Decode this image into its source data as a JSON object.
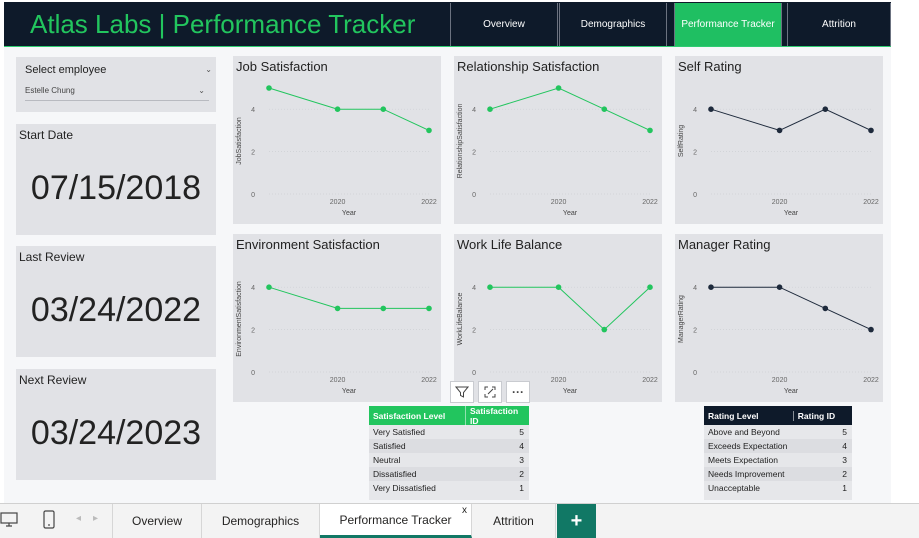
{
  "header": {
    "title": "Atlas Labs | Performance Tracker",
    "nav": [
      {
        "label": "Overview",
        "active": false
      },
      {
        "label": "Demographics",
        "active": false
      },
      {
        "label": "Performance Tracker",
        "active": true
      },
      {
        "label": "Attrition",
        "active": false
      }
    ]
  },
  "slicer": {
    "label": "Select employee",
    "value": "Estelle Chung"
  },
  "cards": {
    "start": {
      "label": "Start Date",
      "value": "07/15/2018"
    },
    "last": {
      "label": "Last Review",
      "value": "03/24/2022"
    },
    "next": {
      "label": "Next Review",
      "value": "03/24/2023"
    }
  },
  "chart_data": [
    {
      "type": "line",
      "title": "Job Satisfaction",
      "xlabel": "Year",
      "ylabel": "JobSatisfaction",
      "x": [
        2018.5,
        2020,
        2021,
        2022
      ],
      "values": [
        5,
        4,
        4,
        3
      ],
      "xticks": [
        "2020",
        "2022"
      ],
      "yticks": [
        "0",
        "2",
        "4"
      ],
      "ylim": [
        0,
        5
      ],
      "color": "#22c55e"
    },
    {
      "type": "line",
      "title": "Relationship Satisfaction",
      "xlabel": "Year",
      "ylabel": "RelationshipSatisfaction",
      "x": [
        2018.5,
        2020,
        2021,
        2022
      ],
      "values": [
        4,
        5,
        4,
        3
      ],
      "xticks": [
        "2020",
        "2022"
      ],
      "yticks": [
        "0",
        "2",
        "4"
      ],
      "ylim": [
        0,
        5
      ],
      "color": "#22c55e"
    },
    {
      "type": "line",
      "title": "Self Rating",
      "xlabel": "Year",
      "ylabel": "SelfRating",
      "x": [
        2018.5,
        2020,
        2021,
        2022
      ],
      "values": [
        4,
        3,
        4,
        3
      ],
      "xticks": [
        "2020",
        "2022"
      ],
      "yticks": [
        "0",
        "2",
        "4"
      ],
      "ylim": [
        0,
        5
      ],
      "color": "#1e2a3c"
    },
    {
      "type": "line",
      "title": "Environment Satisfaction",
      "xlabel": "Year",
      "ylabel": "EnvironmentSatisfaction",
      "x": [
        2018.5,
        2020,
        2021,
        2022
      ],
      "values": [
        4,
        3,
        3,
        3
      ],
      "xticks": [
        "2020",
        "2022"
      ],
      "yticks": [
        "0",
        "2",
        "4"
      ],
      "ylim": [
        0,
        5
      ],
      "color": "#22c55e"
    },
    {
      "type": "line",
      "title": "Work Life Balance",
      "xlabel": "Year",
      "ylabel": "WorkLifeBalance",
      "x": [
        2018.5,
        2020,
        2021,
        2022
      ],
      "values": [
        4,
        4,
        2,
        4
      ],
      "xticks": [
        "2020",
        "2022"
      ],
      "yticks": [
        "0",
        "2",
        "4"
      ],
      "ylim": [
        0,
        5
      ],
      "color": "#22c55e"
    },
    {
      "type": "line",
      "title": "Manager Rating",
      "xlabel": "Year",
      "ylabel": "ManagerRating",
      "x": [
        2018.5,
        2020,
        2021,
        2022
      ],
      "values": [
        4,
        4,
        3,
        2
      ],
      "xticks": [
        "2020",
        "2022"
      ],
      "yticks": [
        "0",
        "2",
        "4"
      ],
      "ylim": [
        0,
        5
      ],
      "color": "#1e2a3c"
    }
  ],
  "satisfaction_table": {
    "headers": [
      "Satisfaction Level",
      "Satisfaction ID"
    ],
    "header_color": "#22c55e",
    "rows": [
      [
        "Very Satisfied",
        "5"
      ],
      [
        "Satisfied",
        "4"
      ],
      [
        "Neutral",
        "3"
      ],
      [
        "Dissatisfied",
        "2"
      ],
      [
        "Very Dissatisfied",
        "1"
      ]
    ]
  },
  "rating_table": {
    "headers": [
      "Rating Level",
      "Rating ID"
    ],
    "header_color": "#0e1a2a",
    "rows": [
      [
        "Above and Beyond",
        "5"
      ],
      [
        "Exceeds Expectation",
        "4"
      ],
      [
        "Meets Expectation",
        "3"
      ],
      [
        "Needs Improvement",
        "2"
      ],
      [
        "Unacceptable",
        "1"
      ]
    ]
  },
  "visual_header": {
    "filter_icon": "filter-icon",
    "focus_icon": "focus-mode-icon",
    "more_label": "···"
  },
  "tabbar": {
    "tabs": [
      {
        "label": "Overview"
      },
      {
        "label": "Demographics"
      },
      {
        "label": "Performance Tracker",
        "active": true
      },
      {
        "label": "Attrition"
      }
    ],
    "close_label": "x",
    "add_label": "+"
  }
}
